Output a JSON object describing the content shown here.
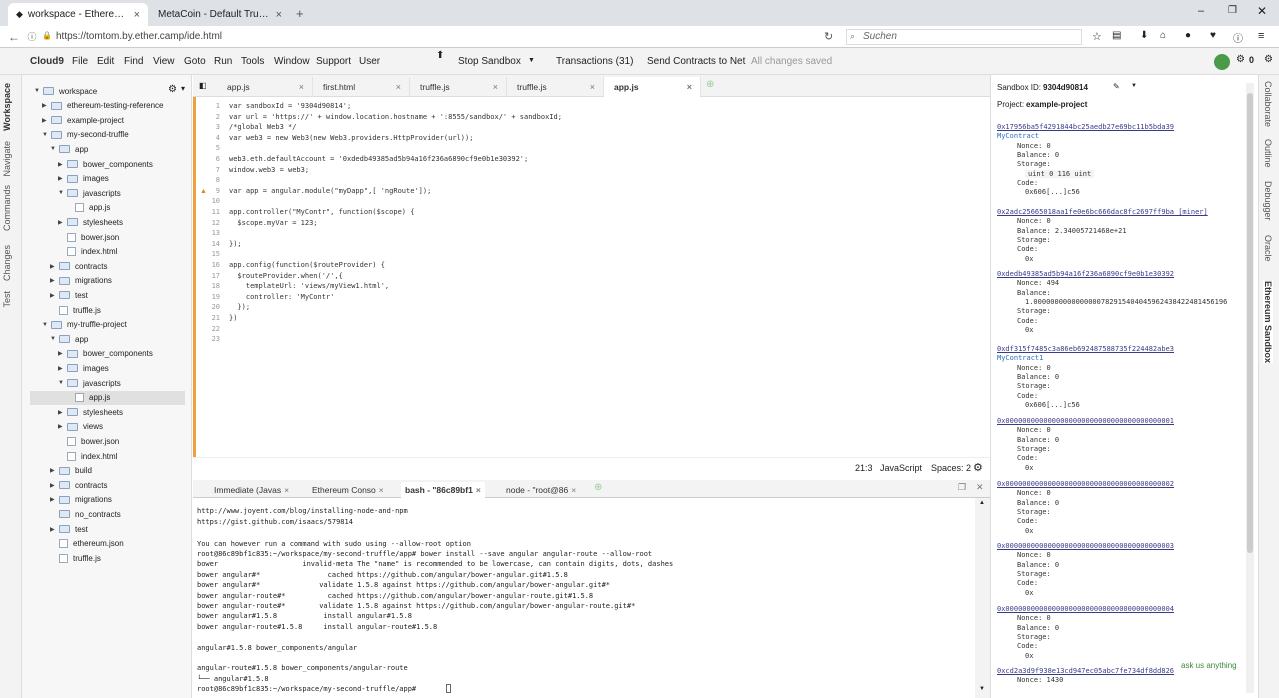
{
  "browser": {
    "tabs": [
      {
        "title": "workspace - Ethereum Stu",
        "active": true
      },
      {
        "title": "MetaCoin - Default Truffle App",
        "active": false
      }
    ],
    "url": "https://tomtom.by.ether.camp/ide.html",
    "search_placeholder": "Suchen"
  },
  "ide_menu": {
    "brand": "Cloud9",
    "items": [
      "File",
      "Edit",
      "Find",
      "View",
      "Goto",
      "Run",
      "Tools",
      "Window",
      "Support",
      "User"
    ],
    "actions": [
      "Stop Sandbox",
      "Transactions (31)",
      "Send Contracts to Net"
    ],
    "status": "All changes saved",
    "badge_count": "0"
  },
  "left_panels": [
    "Workspace",
    "Navigate",
    "Commands",
    "Changes",
    "Test"
  ],
  "right_panels": [
    "Collaborate",
    "Outline",
    "Debugger",
    "Oracle",
    "Ethereum Sandbox"
  ],
  "tree": [
    {
      "label": "workspace",
      "indent": 0,
      "kind": "folder",
      "arrow": "▼"
    },
    {
      "label": "ethereum-testing-reference",
      "indent": 1,
      "kind": "folder",
      "arrow": "▶"
    },
    {
      "label": "example-project",
      "indent": 1,
      "kind": "folder",
      "arrow": "▶"
    },
    {
      "label": "my-second-truffle",
      "indent": 1,
      "kind": "folder",
      "arrow": "▼"
    },
    {
      "label": "app",
      "indent": 2,
      "kind": "folder",
      "arrow": "▼"
    },
    {
      "label": "bower_components",
      "indent": 3,
      "kind": "folder",
      "arrow": "▶"
    },
    {
      "label": "images",
      "indent": 3,
      "kind": "folder",
      "arrow": "▶"
    },
    {
      "label": "javascripts",
      "indent": 3,
      "kind": "folder",
      "arrow": "▼"
    },
    {
      "label": "app.js",
      "indent": 4,
      "kind": "file",
      "arrow": ""
    },
    {
      "label": "stylesheets",
      "indent": 3,
      "kind": "folder",
      "arrow": "▶"
    },
    {
      "label": "bower.json",
      "indent": 3,
      "kind": "file",
      "arrow": ""
    },
    {
      "label": "index.html",
      "indent": 3,
      "kind": "file",
      "arrow": ""
    },
    {
      "label": "contracts",
      "indent": 2,
      "kind": "folder",
      "arrow": "▶"
    },
    {
      "label": "migrations",
      "indent": 2,
      "kind": "folder",
      "arrow": "▶"
    },
    {
      "label": "test",
      "indent": 2,
      "kind": "folder",
      "arrow": "▶"
    },
    {
      "label": "truffle.js",
      "indent": 2,
      "kind": "file",
      "arrow": ""
    },
    {
      "label": "my-truffle-project",
      "indent": 1,
      "kind": "folder",
      "arrow": "▼"
    },
    {
      "label": "app",
      "indent": 2,
      "kind": "folder",
      "arrow": "▼"
    },
    {
      "label": "bower_components",
      "indent": 3,
      "kind": "folder",
      "arrow": "▶"
    },
    {
      "label": "images",
      "indent": 3,
      "kind": "folder",
      "arrow": "▶"
    },
    {
      "label": "javascripts",
      "indent": 3,
      "kind": "folder",
      "arrow": "▼"
    },
    {
      "label": "app.js",
      "indent": 4,
      "kind": "file",
      "arrow": "",
      "selected": true
    },
    {
      "label": "stylesheets",
      "indent": 3,
      "kind": "folder",
      "arrow": "▶"
    },
    {
      "label": "views",
      "indent": 3,
      "kind": "folder",
      "arrow": "▶"
    },
    {
      "label": "bower.json",
      "indent": 3,
      "kind": "file",
      "arrow": ""
    },
    {
      "label": "index.html",
      "indent": 3,
      "kind": "file",
      "arrow": ""
    },
    {
      "label": "build",
      "indent": 2,
      "kind": "folder",
      "arrow": "▶"
    },
    {
      "label": "contracts",
      "indent": 2,
      "kind": "folder",
      "arrow": "▶"
    },
    {
      "label": "migrations",
      "indent": 2,
      "kind": "folder",
      "arrow": "▶"
    },
    {
      "label": "no_contracts",
      "indent": 2,
      "kind": "folder",
      "arrow": ""
    },
    {
      "label": "test",
      "indent": 2,
      "kind": "folder",
      "arrow": "▶"
    },
    {
      "label": "ethereum.json",
      "indent": 2,
      "kind": "file",
      "arrow": ""
    },
    {
      "label": "truffle.js",
      "indent": 2,
      "kind": "file",
      "arrow": ""
    }
  ],
  "editor_tabs": [
    {
      "label": "app.js",
      "active": false
    },
    {
      "label": "first.html",
      "active": false
    },
    {
      "label": "truffle.js",
      "active": false
    },
    {
      "label": "truffle.js",
      "active": false
    },
    {
      "label": "app.js",
      "active": true
    }
  ],
  "code_lines": [
    "var sandboxId = '9304d90814';",
    "var url = 'https://' + window.location.hostname + ':8555/sandbox/' + sandboxId;",
    "/*global Web3 */",
    "var web3 = new Web3(new Web3.providers.HttpProvider(url));",
    "",
    "web3.eth.defaultAccount = '0xdedb49385ad5b94a16f236a6890cf9e0b1e30392';",
    "window.web3 = web3;",
    "",
    "var app = angular.module(\"myDapp\",[ 'ngRoute']);",
    "",
    "app.controller(\"MyContr\", function($scope) {",
    "  $scope.myVar = 123;",
    "",
    "});",
    "",
    "app.config(function($routeProvider) {",
    "  $routeProvider.when('/',{",
    "    templateUrl: 'views/myView1.html',",
    "    controller: 'MyContr'",
    "  });",
    "})",
    "",
    ""
  ],
  "editor_status": {
    "cursor": "21:3",
    "mode": "JavaScript",
    "indent": "Spaces: 2"
  },
  "terminal_tabs": [
    "Immediate (Javas",
    "Ethereum Conso",
    "bash - \"86c89bf1",
    "node - \"root@86"
  ],
  "terminal_lines": [
    "http://www.joyent.com/blog/installing-node-and-npm",
    "https://gist.github.com/isaacs/579814",
    "",
    "You can however run a command with sudo using --allow-root option",
    "root@86c89bf1c835:~/workspace/my-second-truffle/app# bower install --save angular angular-route --allow-root",
    "bower                    invalid-meta The \"name\" is recommended to be lowercase, can contain digits, dots, dashes",
    "bower angular#*                cached https://github.com/angular/bower-angular.git#1.5.8",
    "bower angular#*              validate 1.5.8 against https://github.com/angular/bower-angular.git#*",
    "bower angular-route#*          cached https://github.com/angular/bower-angular-route.git#1.5.8",
    "bower angular-route#*        validate 1.5.8 against https://github.com/angular/bower-angular-route.git#*",
    "bower angular#1.5.8           install angular#1.5.8",
    "bower angular-route#1.5.8     install angular-route#1.5.8",
    "",
    "angular#1.5.8 bower_components/angular",
    "",
    "angular-route#1.5.8 bower_components/angular-route",
    "└── angular#1.5.8",
    "root@86c89bf1c835:~/workspace/my-second-truffle/app# "
  ],
  "sandbox": {
    "id_label": "Sandbox ID:",
    "id": "9304d90814",
    "project_label": "Project:",
    "project": "example-project",
    "accounts": [
      {
        "address": "0x17956ba5f4291844bc25aedb27e69bc11b5bda39",
        "name": "MyContract",
        "fields": [
          "Nonce: 0",
          "Balance: 0",
          "Storage:"
        ],
        "storage": "uint 0 116 uint",
        "code_label": "Code:",
        "code": "0x606[...]c56"
      },
      {
        "address": "0x2adc25665018aa1fe0e6bc666dac8fc2697ff9ba [miner]",
        "name": "",
        "fields": [
          "Nonce: 0",
          "Balance: 2.34005721468e+21",
          "Storage:"
        ],
        "storage": "",
        "code_label": "Code:",
        "code": "0x"
      },
      {
        "address": "0xdedb49385ad5b94a16f236a6890cf9e0b1e30392",
        "name": "",
        "fields": [
          "Nonce: 494",
          "Balance:"
        ],
        "balance_line": "1.0000000000000000782915404045962438422481456196",
        "fields2": [
          "Storage:"
        ],
        "code_label": "Code:",
        "code": "0x"
      },
      {
        "address": "0xdf315f7485c3a86eb692487588735f224482abe3",
        "name": "MyContract1",
        "fields": [
          "Nonce: 0",
          "Balance: 0",
          "Storage:"
        ],
        "storage": "",
        "code_label": "Code:",
        "code": "0x606[...]c56"
      },
      {
        "address": "0x0000000000000000000000000000000000000001",
        "name": "",
        "fields": [
          "Nonce: 0",
          "Balance: 0",
          "Storage:"
        ],
        "storage": "",
        "code_label": "Code:",
        "code": "0x"
      },
      {
        "address": "0x0000000000000000000000000000000000000002",
        "name": "",
        "fields": [
          "Nonce: 0",
          "Balance: 0",
          "Storage:"
        ],
        "storage": "",
        "code_label": "Code:",
        "code": "0x"
      },
      {
        "address": "0x0000000000000000000000000000000000000003",
        "name": "",
        "fields": [
          "Nonce: 0",
          "Balance: 0",
          "Storage:"
        ],
        "storage": "",
        "code_label": "Code:",
        "code": "0x"
      },
      {
        "address": "0x0000000000000000000000000000000000000004",
        "name": "",
        "fields": [
          "Nonce: 0",
          "Balance: 0",
          "Storage:"
        ],
        "storage": "",
        "code_label": "Code:",
        "code": "0x"
      },
      {
        "address": "0xcd2a3d9f938e13cd947ec05abc7fe734df8dd826",
        "name": "",
        "fields": [
          "Nonce: 1430"
        ],
        "storage": "",
        "code_label": "",
        "code": ""
      }
    ],
    "ask_text": "ask us anything"
  },
  "colors": {
    "accent": "#3a3a8a",
    "gutter_marker": "#f0a040",
    "string": "#c0392b"
  }
}
